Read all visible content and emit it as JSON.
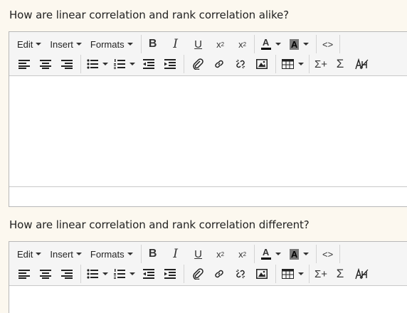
{
  "questions": [
    {
      "text": "How are linear correlation and rank correlation alike?"
    },
    {
      "text": "How are linear correlation and rank correlation different?"
    }
  ],
  "toolbar": {
    "menus": {
      "edit": "Edit",
      "insert": "Insert",
      "formats": "Formats"
    },
    "glyphs": {
      "bold": "B",
      "italic": "I",
      "underline": "U",
      "subscript_base": "x",
      "subscript_mark": "2",
      "superscript_base": "x",
      "superscript_mark": "2",
      "font_color": "A",
      "background_color": "A",
      "source_code": "<>",
      "sigma": "Σ",
      "sigma_plus": "Σ+"
    },
    "icons": [
      "align-left-icon",
      "align-center-icon",
      "align-right-icon",
      "bullet-list-icon",
      "numbered-list-icon",
      "outdent-icon",
      "indent-icon",
      "attachment-icon",
      "link-icon",
      "unlink-icon",
      "image-icon",
      "table-icon",
      "equation-icon",
      "sum-icon",
      "chemistry-icon"
    ]
  },
  "colors": {
    "page_bg": "#fcf8ef",
    "toolbar_bg": "#f5f5f5",
    "border": "#b8b8b8",
    "bg_color_swatch": "#7a7a7a"
  }
}
